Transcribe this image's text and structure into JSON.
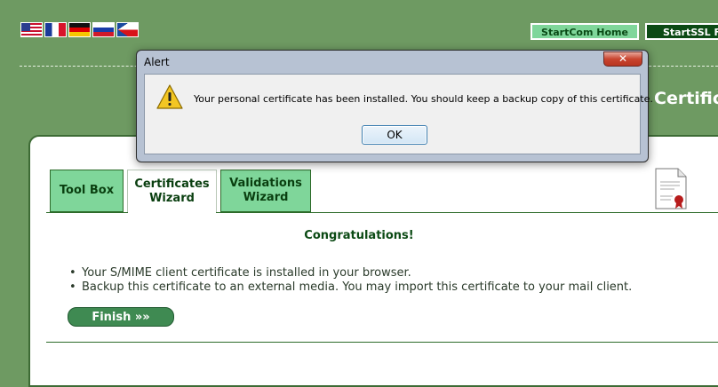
{
  "flags": [
    {
      "icon": "flag-us-icon"
    },
    {
      "icon": "flag-fr-icon"
    },
    {
      "icon": "flag-de-icon"
    },
    {
      "icon": "flag-ru-icon"
    },
    {
      "icon": "flag-cz-icon"
    }
  ],
  "header": {
    "home_label": "StartCom Home",
    "ssl_label": "StartSSL F",
    "section_title": "Certific"
  },
  "tabs": [
    {
      "label_line1": "Tool Box",
      "label_line2": ""
    },
    {
      "label_line1": "Certificates",
      "label_line2": "Wizard"
    },
    {
      "label_line1": "Validations",
      "label_line2": "Wizard"
    }
  ],
  "main": {
    "heading": "Congratulations!",
    "bullets": [
      "Your S/MIME client certificate is installed in your browser.",
      "Backup this certificate to an external media. You may import this certificate to your mail client."
    ],
    "finish_label": "Finish »»"
  },
  "dialog": {
    "title": "Alert",
    "close_label": "✕",
    "message": "Your personal certificate has been installed. You should keep a backup copy of this certificate.",
    "ok_label": "OK"
  },
  "colors": {
    "page_bg": "#6e9a62",
    "tab_bg": "#7fd69a",
    "accent_dark": "#0c4a14",
    "finish_bg": "#3f8a52"
  }
}
